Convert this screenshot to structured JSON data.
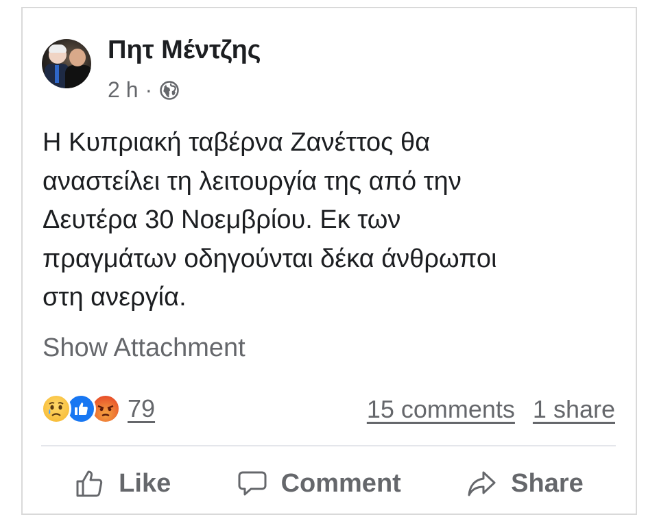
{
  "post": {
    "author_name": "Πητ Μέντζης",
    "time": "2 h",
    "separator": "·",
    "privacy_icon": "globe-icon",
    "text": "Η Κυπριακή ταβέρνα Ζανέττος θα\nαναστείλει τη λειτουργία της από την\nΔευτέρα 30 Νοεμβρίου.  Εκ των\nπραγμάτων οδηγούνται δέκα άνθρωποι\nστη ανεργία.",
    "attachment_label": "Show Attachment"
  },
  "engagement": {
    "reaction_icons": [
      "sad-reaction-icon",
      "like-reaction-icon",
      "angry-reaction-icon"
    ],
    "reaction_count": "79",
    "comments": "15 comments",
    "shares": "1 share"
  },
  "actions": {
    "like_label": "Like",
    "comment_label": "Comment",
    "share_label": "Share"
  },
  "colors": {
    "text_primary": "#1c1e21",
    "text_secondary": "#65676b",
    "like_blue": "#1877f2",
    "card_border": "#d9d9d9"
  }
}
